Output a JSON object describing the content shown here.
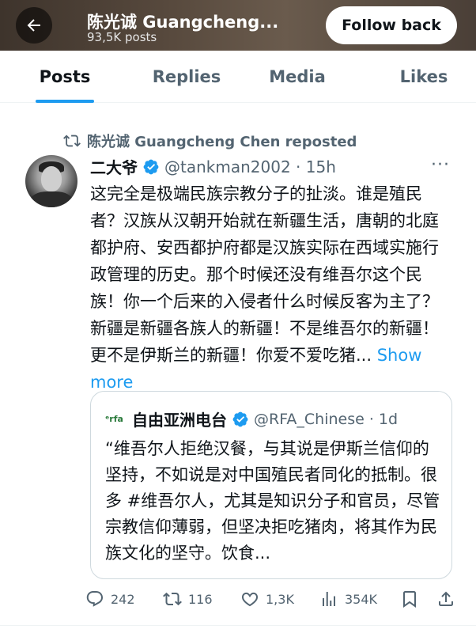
{
  "header": {
    "title": "陈光诚 Guangcheng...",
    "posts_count": "93,5K posts",
    "follow_label": "Follow back"
  },
  "tabs": [
    {
      "label": "Posts",
      "active": true
    },
    {
      "label": "Replies",
      "active": false
    },
    {
      "label": "Media",
      "active": false
    },
    {
      "label": "Likes",
      "active": false
    }
  ],
  "tweet": {
    "repost_text": "陈光诚 Guangcheng Chen reposted",
    "author_name": "二大爷",
    "handle_time": "@tankman2002 · 15h",
    "body": "这完全是极端民族宗教分子的扯淡。谁是殖民者？汉族从汉朝开始就在新疆生活，唐朝的北庭都护府、安西都护府都是汉族实际在西域实施行政管理的历史。那个时候还没有维吾尔这个民族！你一个后来的入侵者什么时候反客为主了？新疆是新疆各族人的新疆！不是维吾尔的新疆！更不是伊斯兰的新疆！你爱不爱吃猪... ",
    "show_more": "Show more",
    "more_icon": "···",
    "quote": {
      "logo_text": "ᵉrfa",
      "name": "自由亚洲电台",
      "handle_time": "@RFA_Chinese · 1d",
      "body": "“维吾尔人拒绝汉餐，与其说是伊斯兰信仰的坚持，不如说是对中国殖民者同化的抵制。很多 #维吾尔人，尤其是知识分子和官员，尽管宗教信仰薄弱，但坚决拒吃猪肉，将其作为民族文化的坚守。饮食..."
    },
    "actions": {
      "replies": "242",
      "reposts": "116",
      "likes": "1,3K",
      "views": "354K"
    }
  },
  "colors": {
    "accent": "#1d9bf0",
    "verified": "#1d9bf0",
    "muted": "#536471"
  }
}
